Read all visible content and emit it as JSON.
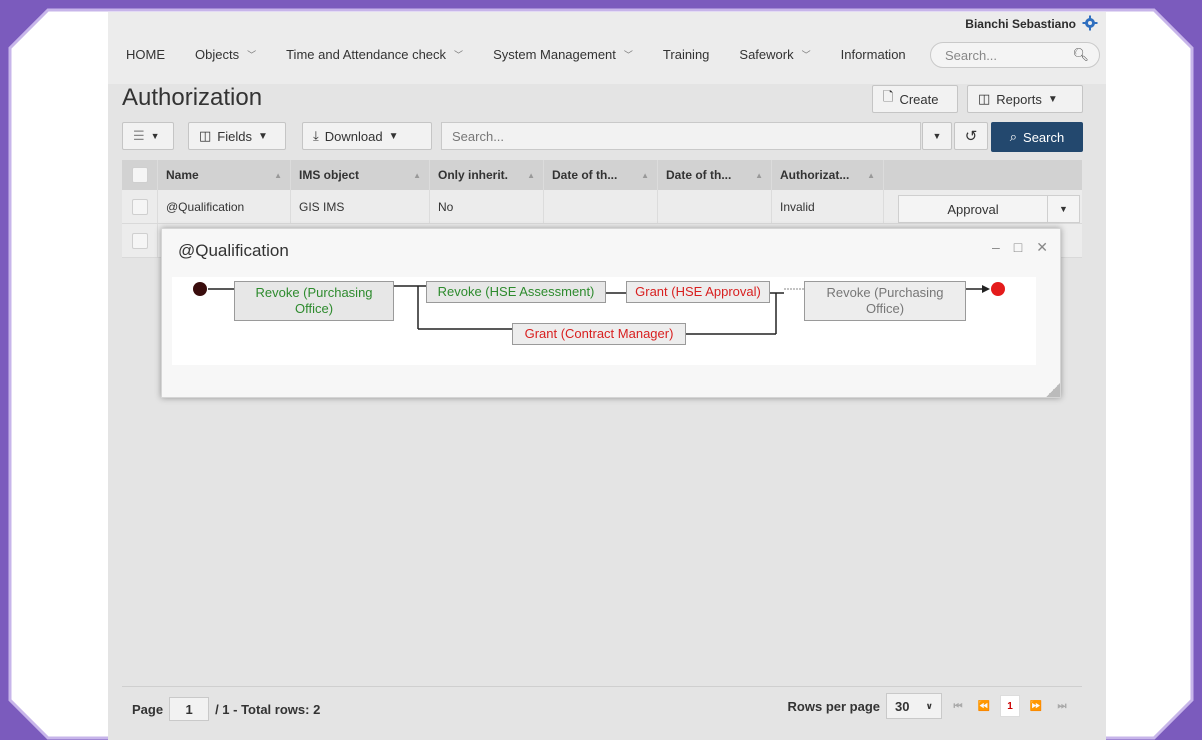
{
  "user": {
    "name": "Bianchi Sebastiano"
  },
  "nav": {
    "items": [
      {
        "label": "HOME",
        "dropdown": false
      },
      {
        "label": "Objects",
        "dropdown": true
      },
      {
        "label": "Time and Attendance check",
        "dropdown": true
      },
      {
        "label": "System Management",
        "dropdown": true
      },
      {
        "label": "Training",
        "dropdown": false
      },
      {
        "label": "Safework",
        "dropdown": true
      },
      {
        "label": "Information",
        "dropdown": false
      }
    ],
    "search_placeholder": "Search..."
  },
  "page": {
    "title": "Authorization"
  },
  "actions": {
    "create": "Create",
    "reports": "Reports"
  },
  "toolbar": {
    "fields": "Fields",
    "download": "Download",
    "search_placeholder": "Search...",
    "search_button": "Search"
  },
  "grid": {
    "columns": [
      "Name",
      "IMS object",
      "Only inherit.",
      "Date of th...",
      "Date of th...",
      "Authorizat..."
    ],
    "rows": [
      {
        "name": "@Qualification",
        "ims": "GIS IMS",
        "inherit": "No",
        "date1": "",
        "date2": "",
        "auth": "Invalid",
        "action": "Approval"
      }
    ]
  },
  "footer": {
    "page_label": "Page",
    "page_value": "1",
    "total": "/ 1 - Total rows: 2",
    "rows_per_page_label": "Rows per page",
    "rows_per_page": "30",
    "current_page": "1"
  },
  "modal": {
    "title": "@Qualification",
    "nodes": {
      "revoke_purchasing_1": "Revoke (Purchasing Office)",
      "revoke_hse": "Revoke (HSE Assessment)",
      "grant_hse": "Grant (HSE Approval)",
      "grant_contract": "Grant (Contract Manager)",
      "revoke_purchasing_2": "Revoke (Purchasing Office)"
    }
  },
  "colors": {
    "accent": "#23486e",
    "frame": "#7b5bbd",
    "grant": "#d81f1f",
    "revoke": "#2e8b2e"
  }
}
